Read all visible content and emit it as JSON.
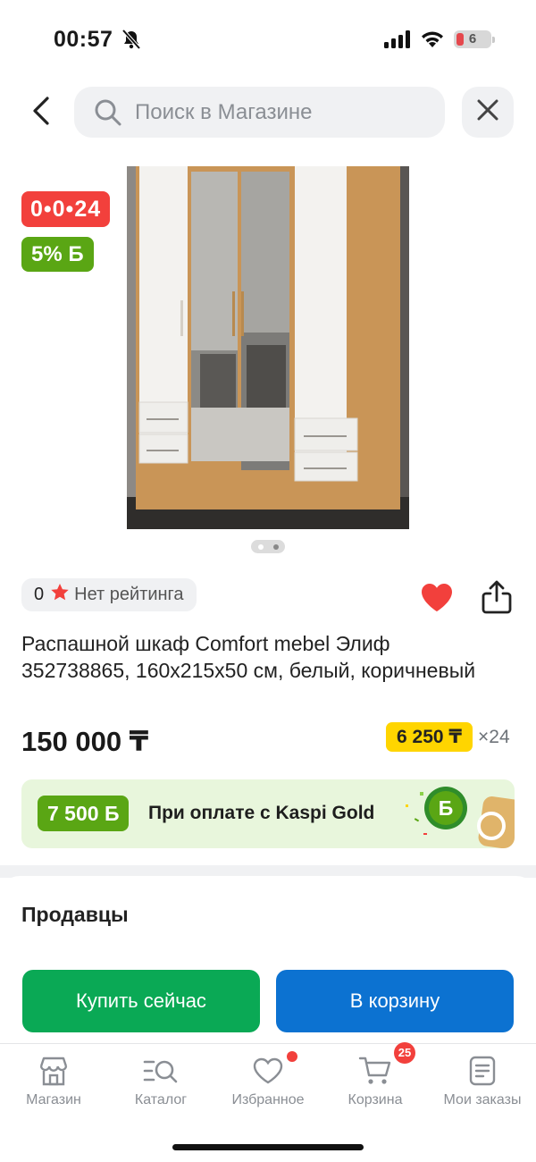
{
  "status_bar": {
    "time": "00:57",
    "battery_level": "6",
    "icons": [
      "bell-off-icon",
      "signal-icon",
      "wifi-icon",
      "battery-icon"
    ]
  },
  "header": {
    "search_placeholder": "Поиск в Магазине",
    "icons": [
      "back-arrow-icon",
      "search-icon",
      "close-icon"
    ]
  },
  "product": {
    "timer_badge": "0•0•24",
    "bonus_badge": "5% Б",
    "image_pages": 2,
    "rating_count": "0",
    "rating_text": "Нет рейтинга",
    "favorite": true,
    "title": "Распашной шкаф Comfort mebel Элиф 352738865, 160x215x50 см, белый, коричневый",
    "price": "150 000 ₸",
    "installment_amount": "6 250 ₸",
    "installment_months": "×24"
  },
  "gold_banner": {
    "bonus": "7 500 Б",
    "text": "При оплате с Kaspi Gold"
  },
  "sellers": {
    "title": "Продавцы"
  },
  "actions": {
    "buy_now": "Купить сейчас",
    "add_to_cart": "В корзину"
  },
  "tabbar": {
    "items": [
      {
        "label": "Магазин",
        "icon": "shop-icon"
      },
      {
        "label": "Каталог",
        "icon": "catalog-icon"
      },
      {
        "label": "Избранное",
        "icon": "heart-icon",
        "dot": true
      },
      {
        "label": "Корзина",
        "icon": "cart-icon",
        "badge": "25"
      },
      {
        "label": "Мои заказы",
        "icon": "orders-icon"
      }
    ]
  },
  "colors": {
    "green": "#0aa955",
    "blue": "#0c72d1",
    "red": "#f2403c",
    "yellow": "#ffd500",
    "bonus_green": "#5aa614"
  }
}
